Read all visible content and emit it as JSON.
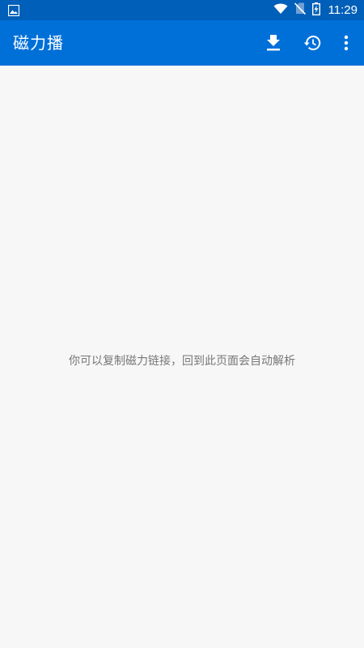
{
  "status_bar": {
    "time": "11:29",
    "icons": [
      "image-notification-icon",
      "wifi-icon",
      "no-sim-icon",
      "battery-charging-icon"
    ]
  },
  "app_bar": {
    "title": "磁力播",
    "actions": [
      "download-icon",
      "history-icon",
      "more-vert-icon"
    ]
  },
  "main": {
    "hint": "你可以复制磁力链接，回到此页面会自动解析"
  },
  "colors": {
    "status_bar": "#005fb8",
    "app_bar": "#0070d9",
    "background": "#f7f7f7",
    "hint_text": "#777777"
  }
}
